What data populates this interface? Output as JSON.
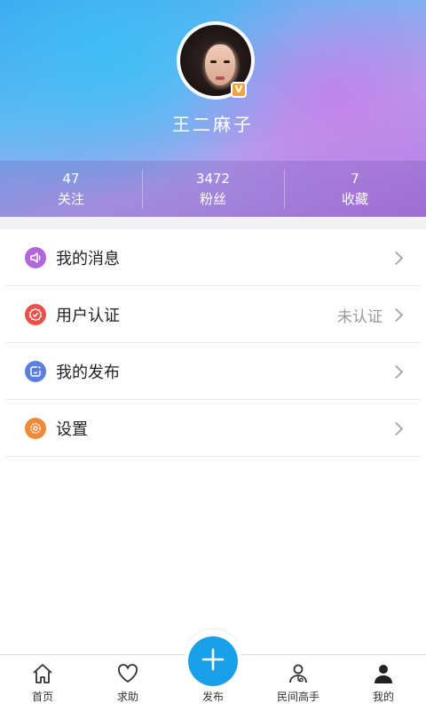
{
  "profile": {
    "username": "王二麻子",
    "verified_badge": "V"
  },
  "stats": [
    {
      "value": "47",
      "label": "关注"
    },
    {
      "value": "3472",
      "label": "粉丝"
    },
    {
      "value": "7",
      "label": "收藏"
    }
  ],
  "menu": [
    {
      "label": "我的消息",
      "status": "",
      "icon": "speaker-icon",
      "color": "#b068d8"
    },
    {
      "label": "用户认证",
      "status": "未认证",
      "icon": "verified-check-icon",
      "color": "#e8524a"
    },
    {
      "label": "我的发布",
      "status": "",
      "icon": "publish-edit-icon",
      "color": "#5a7fe0"
    },
    {
      "label": "设置",
      "status": "",
      "icon": "settings-gear-icon",
      "color": "#f08a3a"
    }
  ],
  "tabbar": {
    "home": "首页",
    "help": "求助",
    "publish": "发布",
    "experts": "民间高手",
    "mine": "我的",
    "publish_color": "#1aa0e8"
  }
}
